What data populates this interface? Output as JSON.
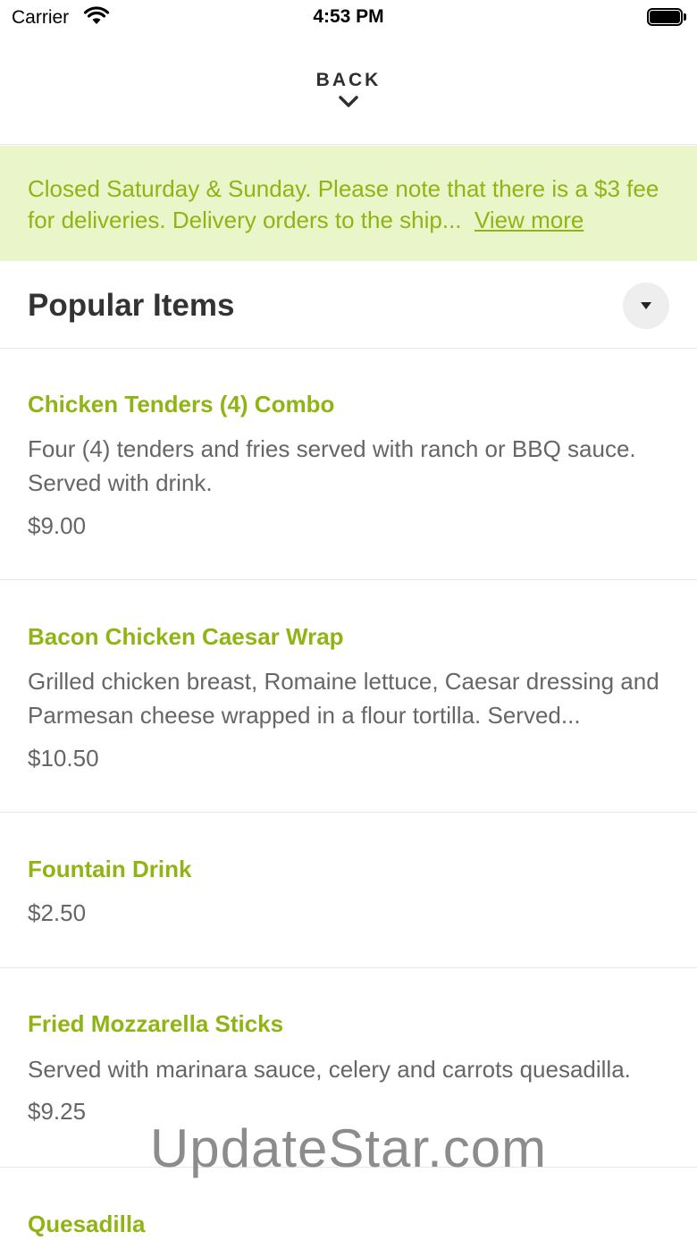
{
  "status_bar": {
    "carrier": "Carrier",
    "time": "4:53 PM"
  },
  "header": {
    "back_label": "BACK"
  },
  "notice": {
    "text": "Closed Saturday & Sunday. Please note that there is a $3 fee for deliveries. Delivery orders to the ship...",
    "link": "View more"
  },
  "section": {
    "title": "Popular Items"
  },
  "items": [
    {
      "name": "Chicken Tenders (4) Combo",
      "description": "Four (4) tenders and fries served with ranch or BBQ sauce. Served with drink.",
      "price": "$9.00"
    },
    {
      "name": "Bacon Chicken Caesar Wrap",
      "description": "Grilled chicken breast, Romaine lettuce, Caesar dressing and Parmesan cheese wrapped in a flour tortilla. Served...",
      "price": "$10.50"
    },
    {
      "name": "Fountain Drink",
      "description": "",
      "price": "$2.50"
    },
    {
      "name": "Fried Mozzarella Sticks",
      "description": "Served with marinara sauce, celery and carrots quesadilla.",
      "price": "$9.25"
    },
    {
      "name": "Quesadilla",
      "description": "",
      "price": ""
    }
  ],
  "watermark": "UpdateStar.com",
  "colors": {
    "accent": "#8fb413",
    "notice_bg": "#eaf6c9",
    "text": "#333333",
    "muted": "#666666"
  }
}
